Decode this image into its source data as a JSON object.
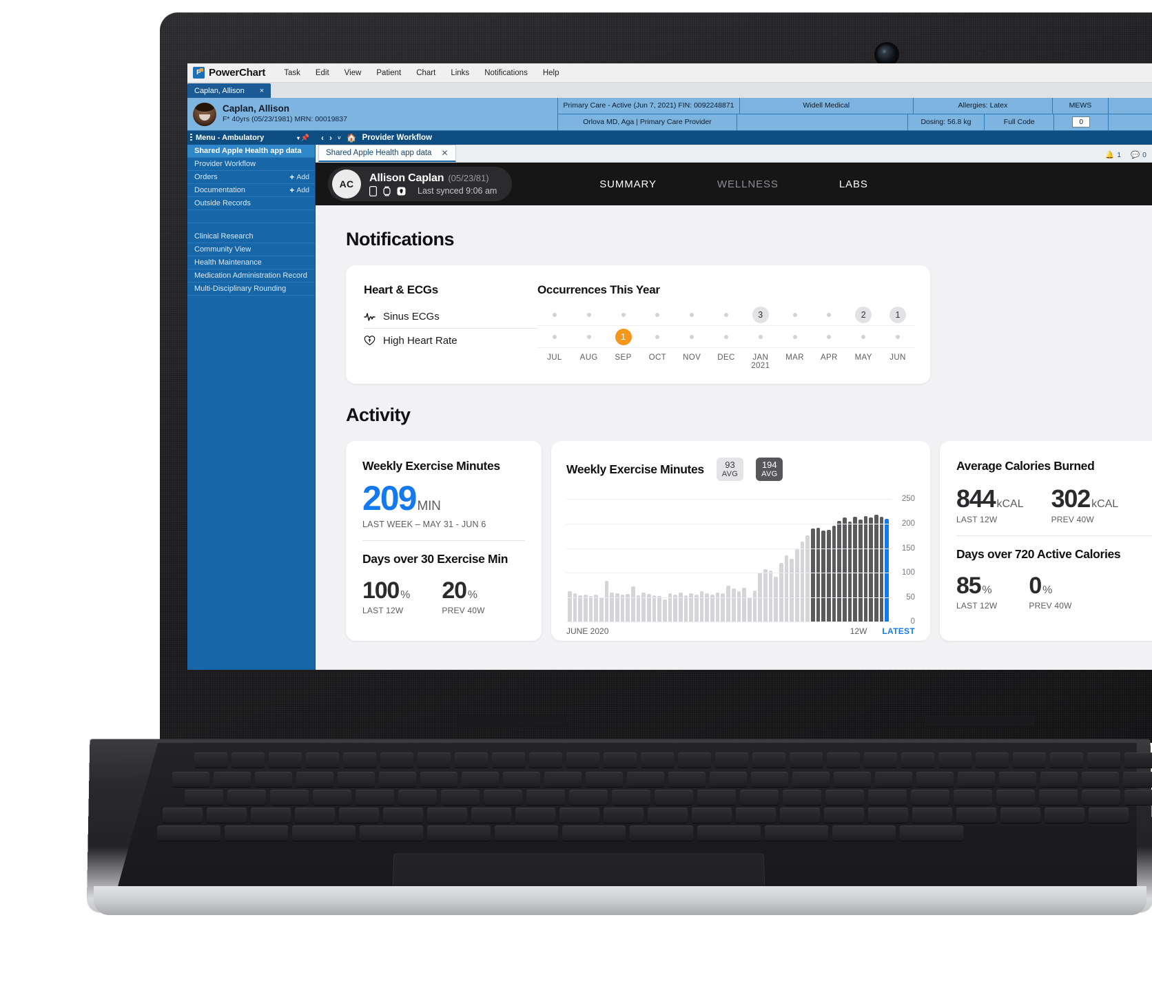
{
  "app": {
    "name": "PowerChart",
    "menu": [
      "Task",
      "Edit",
      "View",
      "Patient",
      "Chart",
      "Links",
      "Notifications",
      "Help"
    ],
    "tab_label": "Caplan, Allison",
    "tab_close": "×"
  },
  "banner": {
    "patient_name": "Caplan, Allison",
    "patient_sub": "F* 40yrs (05/23/1981)   MRN: 00019837",
    "encounter": "Primary Care - Active (Jun 7, 2021)  FIN: 0092248871",
    "facility": "Widell Medical",
    "allergies": "Allergies: Latex",
    "mews_label": "MEWS",
    "mews_value": "0",
    "provider": "Orlova MD, Aga  |  Primary Care Provider",
    "dosing": "Dosing: 56.8 kg",
    "code_status": "Full Code"
  },
  "sidebar": {
    "header": "Menu - Ambulatory",
    "items": [
      {
        "label": "Shared Apple Health app data",
        "active": true,
        "add": ""
      },
      {
        "label": "Provider Workflow",
        "active": false,
        "add": ""
      },
      {
        "label": "Orders",
        "active": false,
        "add": "Add"
      },
      {
        "label": "Documentation",
        "active": false,
        "add": "Add"
      },
      {
        "label": "Outside Records",
        "active": false,
        "add": ""
      }
    ],
    "items2": [
      {
        "label": "Clinical Research"
      },
      {
        "label": "Community View"
      },
      {
        "label": "Health Maintenance"
      },
      {
        "label": "Medication Administration Record"
      },
      {
        "label": "Multi-Disciplinary Rounding"
      }
    ]
  },
  "navbar": {
    "back": "‹",
    "forward": "›",
    "caret": "˅",
    "title": "Provider Workflow",
    "home_icon": "home-icon"
  },
  "subtabs": {
    "active_tab": "Shared Apple Health app data",
    "close": "✕",
    "alert_count": "1",
    "comment_count": "0"
  },
  "health": {
    "initials": "AC",
    "name": "Allison Caplan",
    "dob": "(05/23/81)",
    "sync": "Last  synced 9:06 am",
    "devices": [
      "iphone-icon",
      "watch-icon",
      "airpods-icon"
    ],
    "tabs": [
      {
        "label": "SUMMARY",
        "active": true
      },
      {
        "label": "WELLNESS",
        "active": false
      },
      {
        "label": "LABS",
        "active": true
      }
    ]
  },
  "notifications": {
    "section_title": "Notifications",
    "left_title": "Heart & ECGs",
    "rows": [
      {
        "label": "Sinus ECGs",
        "icon": "ecg-waveform-icon"
      },
      {
        "label": "High Heart Rate",
        "icon": "heart-alert-icon"
      }
    ],
    "right_title": "Occurrences This Year",
    "months": [
      "JUL",
      "AUG",
      "SEP",
      "OCT",
      "NOV",
      "DEC",
      "JAN 2021",
      "MAR",
      "APR",
      "MAY",
      "JUN"
    ],
    "row_sinus": [
      null,
      null,
      null,
      null,
      null,
      null,
      "3",
      null,
      null,
      "2",
      "1"
    ],
    "row_highhr": [
      null,
      null,
      "1",
      null,
      null,
      null,
      null,
      null,
      null,
      null,
      null
    ],
    "orange_hex": "#f5971d"
  },
  "activity": {
    "section_title": "Activity",
    "card1": {
      "title": "Weekly Exercise Minutes",
      "value": "209",
      "unit": "MIN",
      "sub": "LAST WEEK – MAY 31 - JUN 6",
      "sub_title": "Days over 30 Exercise Min",
      "stats": [
        {
          "num": "100",
          "unit": "%",
          "label": "LAST 12W"
        },
        {
          "num": "20",
          "unit": "%",
          "label": "PREV 40W"
        }
      ]
    },
    "card2": {
      "title": "Weekly Exercise Minutes",
      "avg_light": {
        "value": "93",
        "label": "AVG"
      },
      "avg_dark": {
        "value": "194",
        "label": "AVG"
      },
      "start_label": "JUNE 2020",
      "range_label": "12W",
      "latest_label": "LATEST"
    },
    "card3": {
      "title": "Average Calories Burned",
      "values": [
        {
          "num": "844",
          "unit": "kCAL",
          "label": "LAST 12W"
        },
        {
          "num": "302",
          "unit": "kCAL",
          "label": "PREV 40W"
        }
      ],
      "sub_title": "Days over 720 Active Calories",
      "stats": [
        {
          "num": "85",
          "unit": "%",
          "label": "LAST 12W"
        },
        {
          "num": "0",
          "unit": "%",
          "label": "PREV 40W"
        }
      ]
    }
  },
  "chart_data": {
    "type": "bar",
    "title": "Weekly Exercise Minutes",
    "xlabel": "",
    "ylabel": "",
    "ylim": [
      0,
      250
    ],
    "yticks": [
      0,
      50,
      100,
      150,
      200,
      250
    ],
    "grid": true,
    "x_start_label": "JUNE 2020",
    "legend": [
      "12W",
      "LATEST"
    ],
    "annotations": [
      {
        "text": "93 AVG",
        "style": "light"
      },
      {
        "text": "194 AVG",
        "style": "dark"
      }
    ],
    "series": [
      {
        "name": "Weekly Exercise Minutes",
        "values": [
          62,
          58,
          54,
          56,
          52,
          55,
          50,
          84,
          60,
          58,
          55,
          57,
          72,
          54,
          60,
          57,
          54,
          52,
          46,
          58,
          56,
          60,
          54,
          58,
          56,
          62,
          58,
          55,
          60,
          58,
          74,
          68,
          62,
          70,
          50,
          64,
          100,
          108,
          104,
          92,
          120,
          136,
          128,
          148,
          164,
          176,
          190,
          192,
          186,
          188,
          196,
          206,
          212,
          204,
          214,
          208,
          216,
          212,
          218,
          214,
          210
        ],
        "colors": [
          "light",
          "light",
          "light",
          "light",
          "light",
          "light",
          "light",
          "light",
          "light",
          "light",
          "light",
          "light",
          "light",
          "light",
          "light",
          "light",
          "light",
          "light",
          "light",
          "light",
          "light",
          "light",
          "light",
          "light",
          "light",
          "light",
          "light",
          "light",
          "light",
          "light",
          "light",
          "light",
          "light",
          "light",
          "light",
          "light",
          "light",
          "light",
          "light",
          "light",
          "light",
          "light",
          "light",
          "light",
          "light",
          "light",
          "dark",
          "dark",
          "dark",
          "dark",
          "dark",
          "dark",
          "dark",
          "dark",
          "dark",
          "dark",
          "dark",
          "dark",
          "dark",
          "dark",
          "blue"
        ]
      }
    ],
    "colors": {
      "light": "#d5d5d9",
      "dark": "#5b5b5e",
      "blue": "#1479ec"
    }
  }
}
